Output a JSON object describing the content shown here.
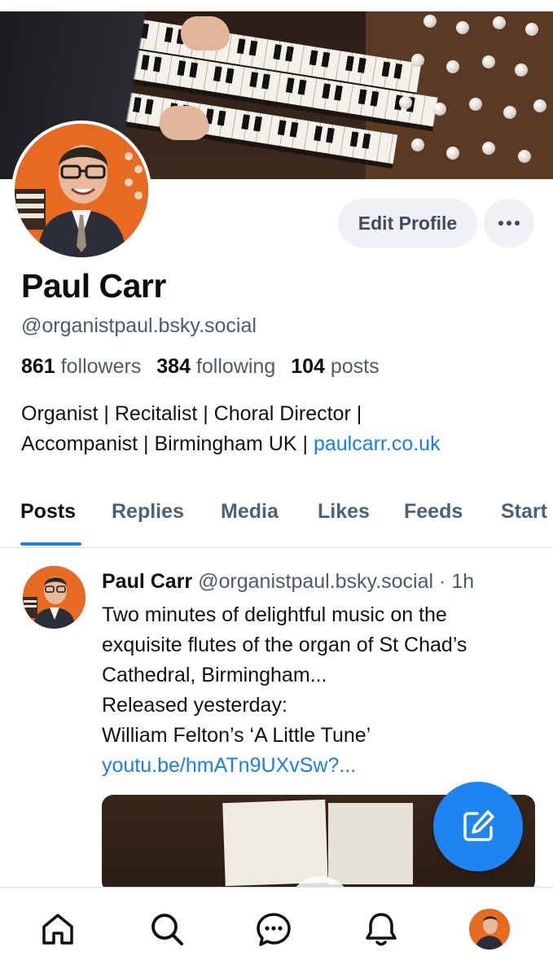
{
  "profile": {
    "display_name": "Paul Carr",
    "handle": "@organistpaul.bsky.social",
    "followers_count": "861",
    "followers_label": "followers",
    "following_count": "384",
    "following_label": "following",
    "posts_count": "104",
    "posts_label": "posts",
    "bio_line1": "Organist | Recitalist | Choral Director |",
    "bio_line2_text": "Accompanist | Birmingham UK | ",
    "bio_link": "paulcarr.co.uk",
    "edit_button_label": "Edit Profile",
    "more_button_label": "···"
  },
  "tabs": [
    {
      "label": "Posts",
      "active": true
    },
    {
      "label": "Replies",
      "active": false
    },
    {
      "label": "Media",
      "active": false
    },
    {
      "label": "Likes",
      "active": false
    },
    {
      "label": "Feeds",
      "active": false
    },
    {
      "label": "Start",
      "active": false
    }
  ],
  "post": {
    "author_name": "Paul Carr",
    "author_handle": "@organistpaul.bsky.social",
    "separator": "·",
    "time": "1h",
    "lines": [
      "Two minutes of delightful music on the",
      "exquisite flutes of the organ of St Chad’s",
      "Cathedral, Birmingham...",
      "Released yesterday:",
      "William Felton’s ‘A Little Tune’"
    ],
    "link": "youtu.be/hmATn9UXvSw?..."
  },
  "fab": {
    "icon": "compose-icon"
  },
  "bottom_nav": [
    {
      "icon": "home-icon"
    },
    {
      "icon": "search-icon"
    },
    {
      "icon": "chat-icon"
    },
    {
      "icon": "bell-icon"
    },
    {
      "icon": "avatar"
    }
  ],
  "colors": {
    "accent": "#1d84f2",
    "link": "#1a7fe8",
    "secondary_text": "#4d5b6d"
  }
}
